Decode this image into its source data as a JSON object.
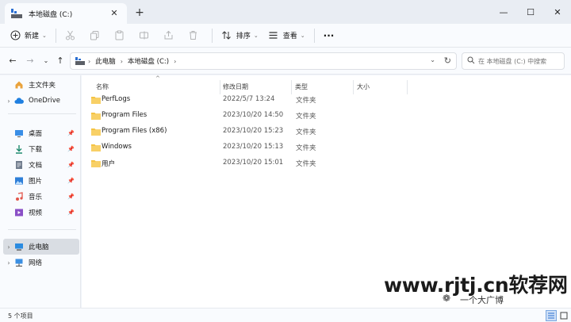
{
  "titlebar": {
    "tab_title": "本地磁盘 (C:)",
    "close_tab": "✕",
    "new_tab": "+",
    "minimize": "—",
    "maximize": "☐",
    "close": "✕"
  },
  "toolbar": {
    "new_label": "新建",
    "sort_label": "排序",
    "view_label": "查看",
    "more_label": "···"
  },
  "address": {
    "crumbs": [
      "此电脑",
      "本地磁盘 (C:)"
    ],
    "search_placeholder": "在 本地磁盘 (C:) 中搜索"
  },
  "sidebar": {
    "items": [
      {
        "label": "主文件夹",
        "icon": "home-icon"
      },
      {
        "label": "OneDrive",
        "icon": "cloud-icon"
      },
      {
        "label": "桌面",
        "icon": "desktop-icon"
      },
      {
        "label": "下载",
        "icon": "download-icon"
      },
      {
        "label": "文档",
        "icon": "document-icon"
      },
      {
        "label": "图片",
        "icon": "picture-icon"
      },
      {
        "label": "音乐",
        "icon": "music-icon"
      },
      {
        "label": "视频",
        "icon": "video-icon"
      },
      {
        "label": "此电脑",
        "icon": "computer-icon"
      },
      {
        "label": "网络",
        "icon": "network-icon"
      }
    ]
  },
  "columns": {
    "name": "名称",
    "date": "修改日期",
    "type": "类型",
    "size": "大小"
  },
  "files": [
    {
      "name": "PerfLogs",
      "date": "2022/5/7 13:24",
      "type": "文件夹"
    },
    {
      "name": "Program Files",
      "date": "2023/10/20 14:50",
      "type": "文件夹"
    },
    {
      "name": "Program Files (x86)",
      "date": "2023/10/20 15:23",
      "type": "文件夹"
    },
    {
      "name": "Windows",
      "date": "2023/10/20 15:13",
      "type": "文件夹"
    },
    {
      "name": "用户",
      "date": "2023/10/20 15:01",
      "type": "文件夹"
    }
  ],
  "status": {
    "count": "5 个项目"
  },
  "watermark": {
    "site": "www.rjtj.cn软荐网",
    "author": "一个大广博"
  },
  "colors": {
    "accent": "#2b6fd1",
    "folder": "#f5c343",
    "selected": "#d9dde3"
  }
}
